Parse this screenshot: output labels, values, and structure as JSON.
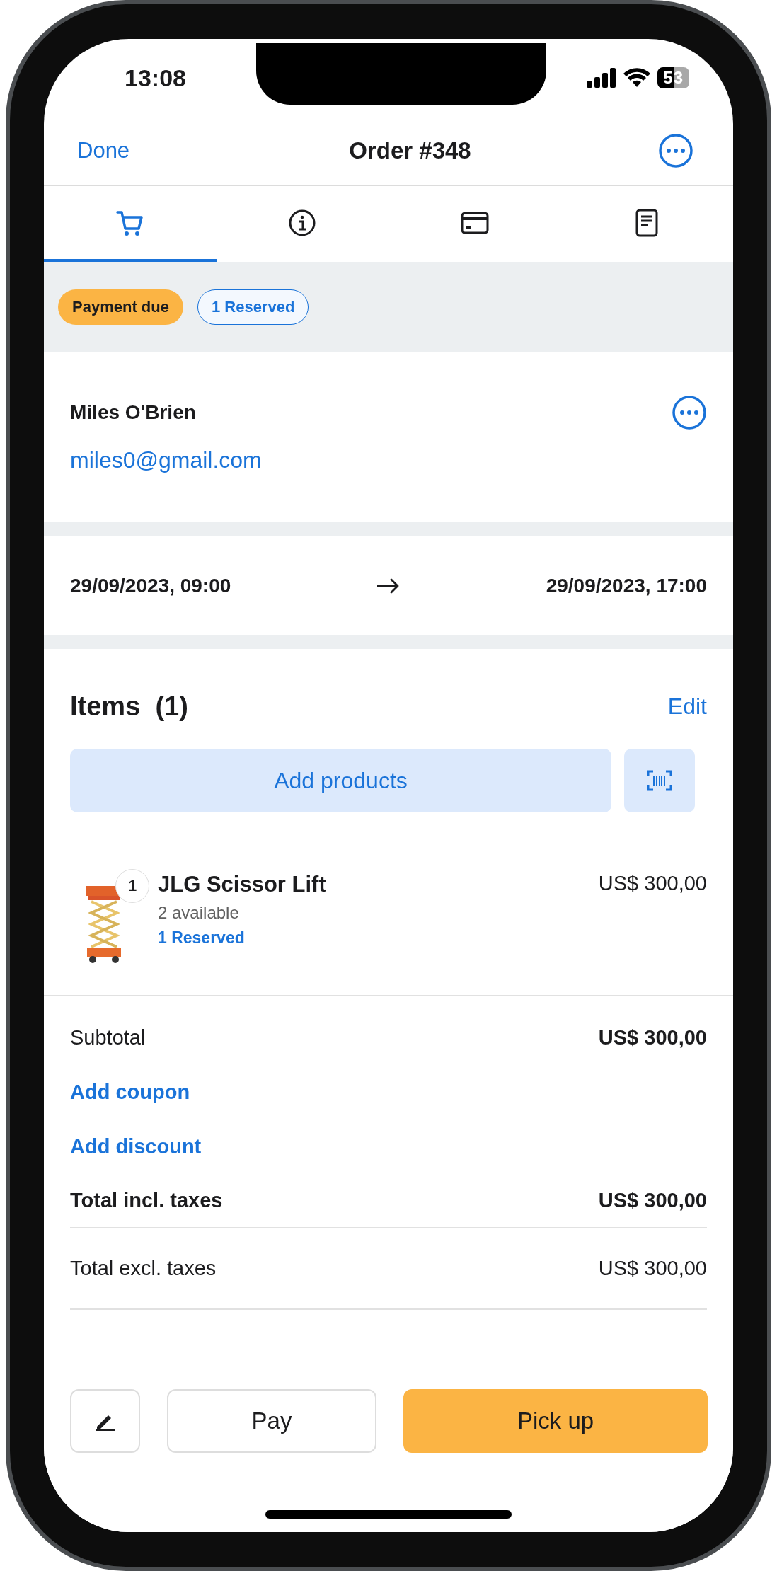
{
  "status_bar": {
    "time": "13:08",
    "battery": "53"
  },
  "nav": {
    "back": "Done",
    "title": "Order #348"
  },
  "tabs": [
    {
      "kind": "cart",
      "selected": true
    },
    {
      "kind": "info",
      "selected": false
    },
    {
      "kind": "card",
      "selected": false
    },
    {
      "kind": "document",
      "selected": false
    }
  ],
  "badges": [
    {
      "label": "Payment due",
      "kind": "filled"
    },
    {
      "label": "1 Reserved",
      "kind": "outline"
    }
  ],
  "customer": {
    "name": "Miles O'Brien",
    "email": "miles0@gmail.com"
  },
  "period": {
    "start": "29/09/2023, 09:00",
    "end": "29/09/2023, 17:00"
  },
  "items": {
    "title": "Items  (1)",
    "edit": "Edit",
    "add": "Add products",
    "list": [
      {
        "quantity": "1",
        "name": "JLG Scissor Lift",
        "availability": "2 available",
        "reservation": "1 Reserved",
        "price": "US$ 300,00"
      }
    ]
  },
  "totals": [
    {
      "label": "Subtotal",
      "value": "US$ 300,00",
      "kind": "subtotal"
    },
    {
      "label": "Add coupon",
      "kind": "link"
    },
    {
      "label": "Add discount",
      "kind": "link"
    },
    {
      "label": "Total incl. taxes",
      "value": "US$ 300,00",
      "kind": "total"
    },
    {
      "label": "Total excl. taxes",
      "value": "US$ 300,00",
      "kind": "plain"
    }
  ],
  "actions": [
    {
      "kind": "icon"
    },
    {
      "label": "Pay",
      "kind": "secondary"
    },
    {
      "label": "Pick up",
      "kind": "primary"
    }
  ]
}
